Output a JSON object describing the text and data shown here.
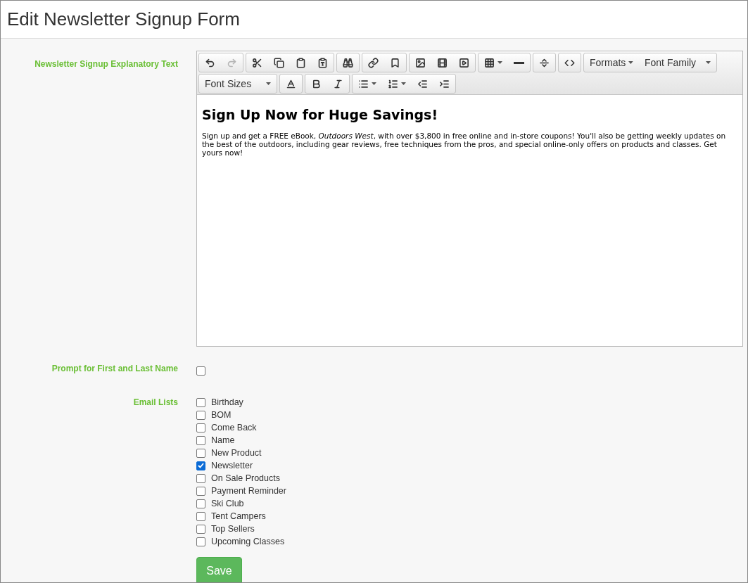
{
  "title": "Edit Newsletter Signup Form",
  "explanatory": {
    "label": "Newsletter Signup Explanatory Text",
    "toolbar": {
      "redo_disabled": true,
      "formats": "Formats",
      "font_family": "Font Family",
      "font_sizes": "Font Sizes"
    },
    "heading": "Sign Up Now for Huge Savings!",
    "body": "Sign up and get a FREE eBook, *Outdoors West*, with over $3,800 in free online and in-store coupons! You'll also be getting weekly updates on the best of the outdoors, including gear reviews, free techniques from the pros, and special online-only offers on products and classes. Get yours now!"
  },
  "prompt_name": {
    "label": "Prompt for First and Last Name",
    "checked": false
  },
  "email_lists": {
    "label": "Email Lists",
    "items": [
      {
        "label": "Birthday",
        "checked": false
      },
      {
        "label": "BOM",
        "checked": false
      },
      {
        "label": "Come Back",
        "checked": false
      },
      {
        "label": "Name",
        "checked": false
      },
      {
        "label": "New Product",
        "checked": false
      },
      {
        "label": "Newsletter",
        "checked": true
      },
      {
        "label": "On Sale Products",
        "checked": false
      },
      {
        "label": "Payment Reminder",
        "checked": false
      },
      {
        "label": "Ski Club",
        "checked": false
      },
      {
        "label": "Tent Campers",
        "checked": false
      },
      {
        "label": "Top Sellers",
        "checked": false
      },
      {
        "label": "Upcoming Classes",
        "checked": false
      }
    ]
  },
  "save": "Save"
}
